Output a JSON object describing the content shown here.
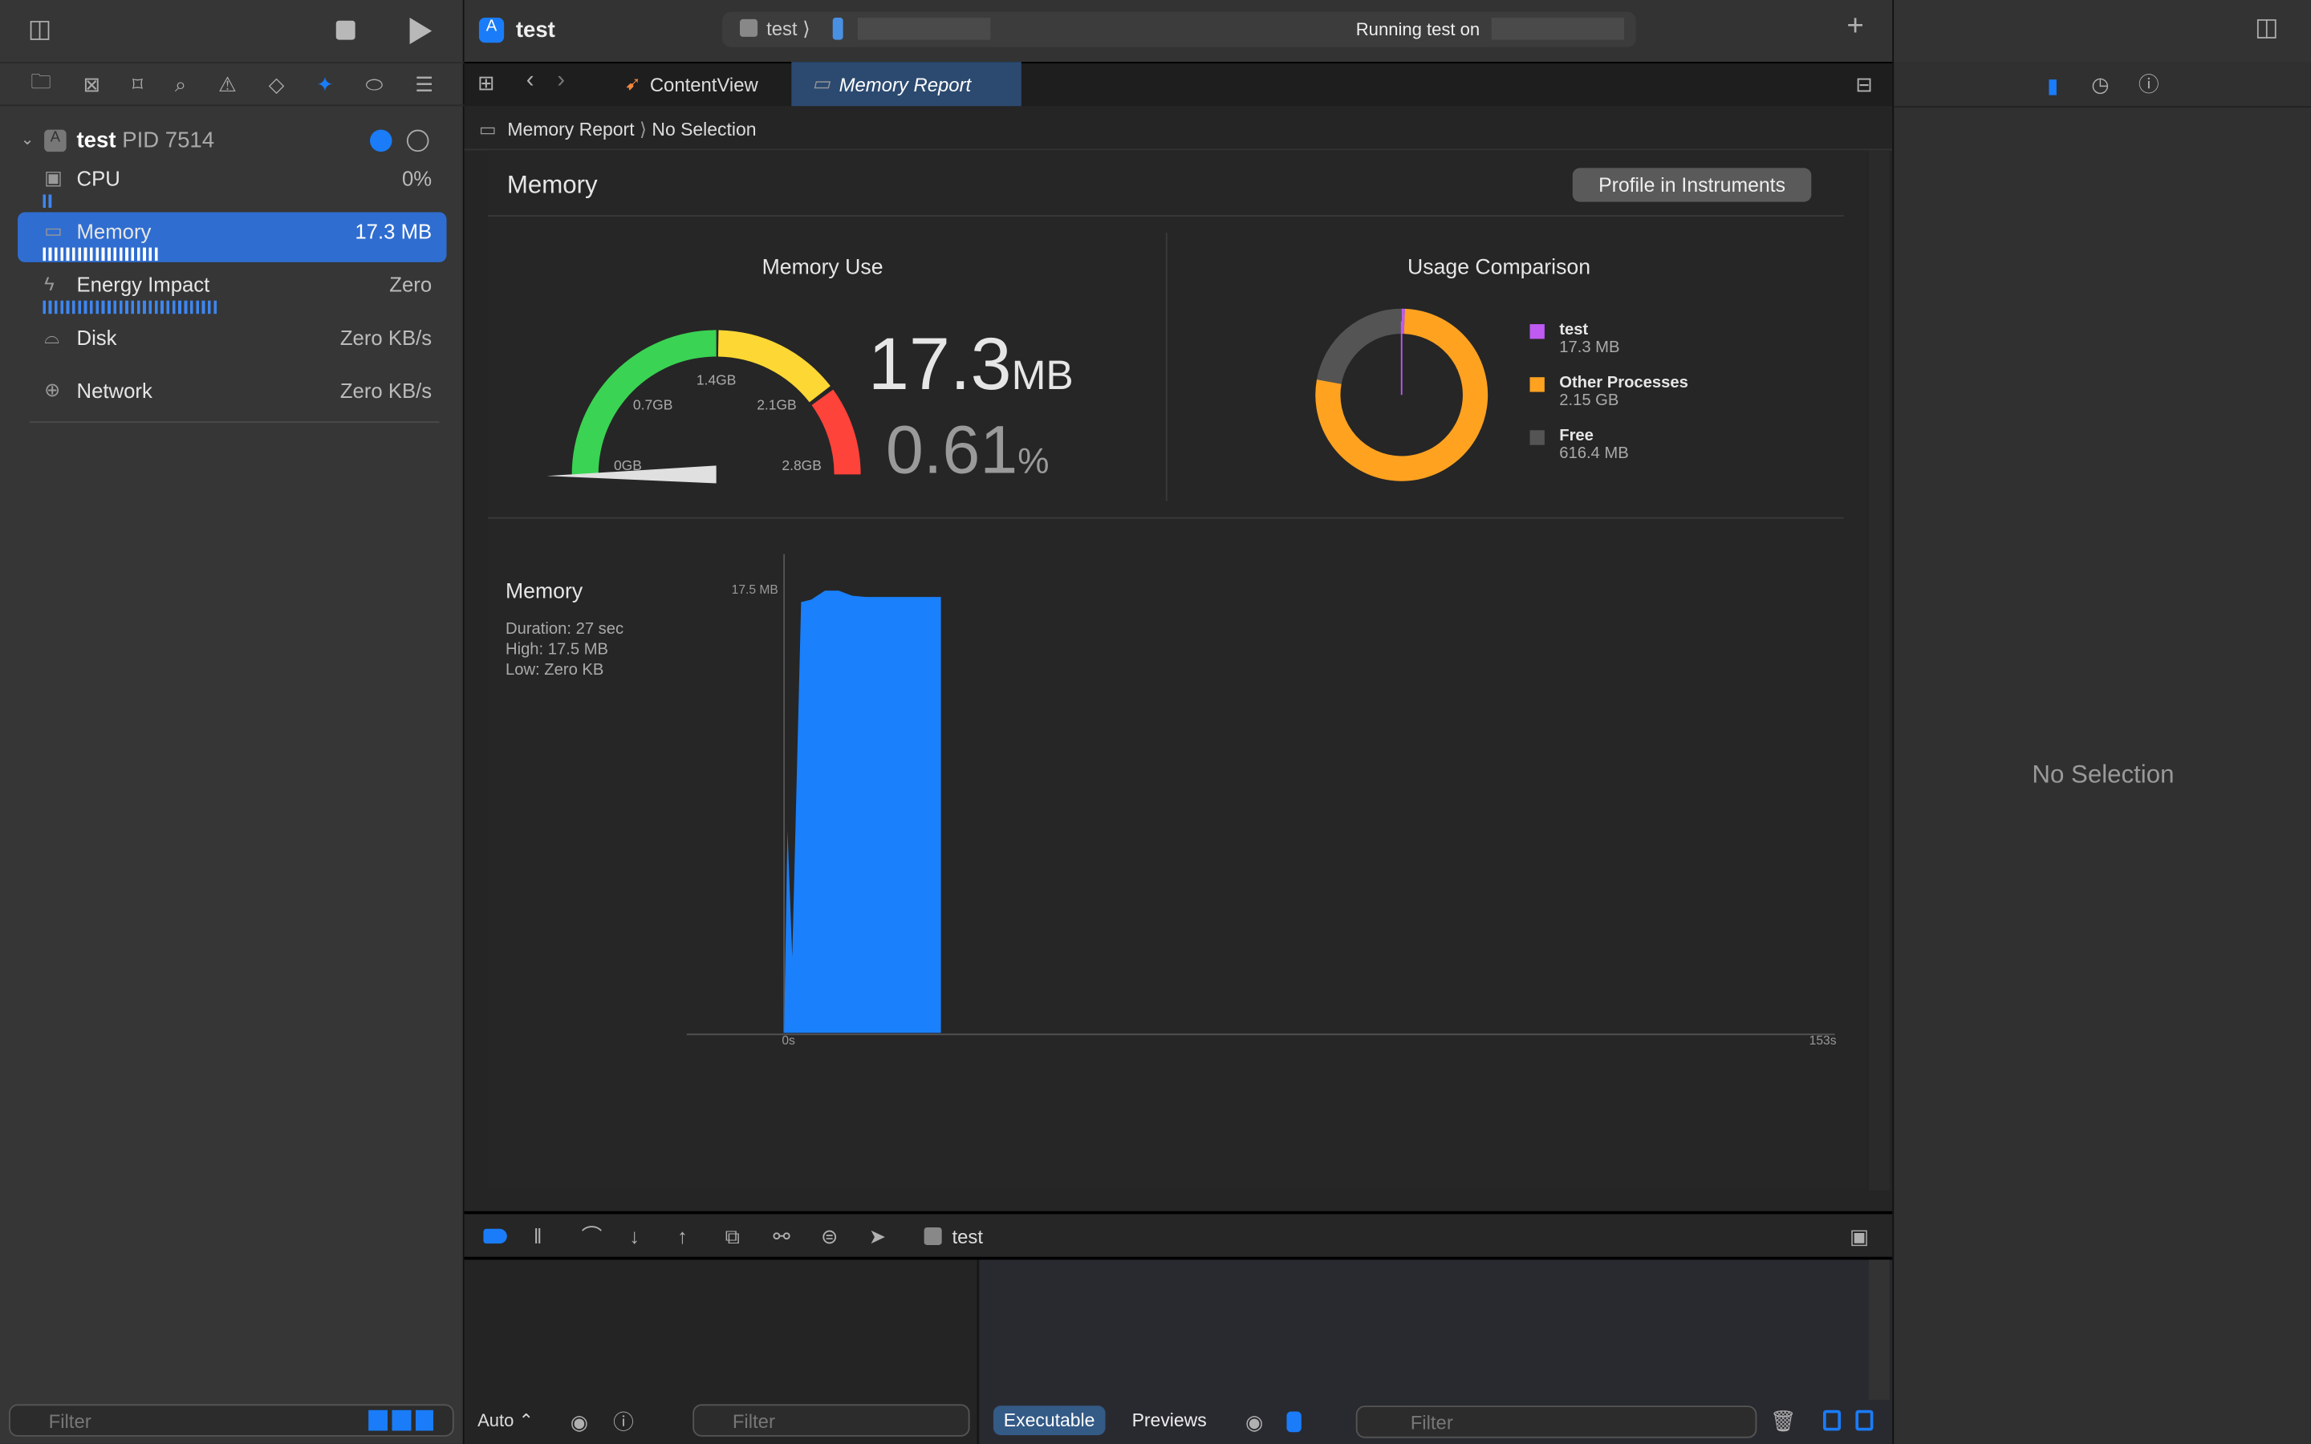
{
  "toolbar": {
    "project": "test",
    "scheme": "test",
    "scheme_sep": "⟩",
    "status": "Running test on",
    "add_icon": "plus-icon"
  },
  "navigator": {
    "icons": [
      "folder-icon",
      "source-control-icon",
      "bookmark-icon",
      "search-icon",
      "warning-icon",
      "test-icon",
      "debug-icon",
      "breakpoint-icon",
      "report-icon"
    ],
    "process": {
      "name": "test",
      "pid": "PID 7514"
    },
    "items": [
      {
        "label": "CPU",
        "value": "0%",
        "icon": "cpu-icon"
      },
      {
        "label": "Memory",
        "value": "17.3 MB",
        "icon": "memory-icon",
        "selected": true
      },
      {
        "label": "Energy Impact",
        "value": "Zero",
        "icon": "bolt-icon"
      },
      {
        "label": "Disk",
        "value": "Zero KB/s",
        "icon": "disk-icon"
      },
      {
        "label": "Network",
        "value": "Zero KB/s",
        "icon": "globe-icon"
      }
    ],
    "filter_placeholder": "Filter"
  },
  "tabs": [
    {
      "label": "ContentView",
      "active": false
    },
    {
      "label": "Memory Report",
      "active": true
    }
  ],
  "breadcrumb": [
    "Memory Report",
    "No Selection"
  ],
  "report": {
    "title": "Memory",
    "profile_button": "Profile in Instruments",
    "memory_use": {
      "title": "Memory Use",
      "value": "17.3",
      "unit": "MB",
      "percent": "0.61",
      "percent_unit": "%",
      "gauge_labels": [
        "0GB",
        "0.7GB",
        "1.4GB",
        "2.1GB",
        "2.8GB"
      ],
      "gauge_fraction": 0.0061,
      "colors": {
        "green": "#3ad353",
        "yellow": "#fdd733",
        "red": "#fd433a"
      }
    },
    "usage": {
      "title": "Usage Comparison",
      "legend": [
        {
          "name": "test",
          "value": "17.3 MB",
          "color": "#bf5af2"
        },
        {
          "name": "Other Processes",
          "value": "2.15 GB",
          "color": "#fea220"
        },
        {
          "name": "Free",
          "value": "616.4 MB",
          "color": "#545454"
        }
      ]
    },
    "timeline": {
      "title": "Memory",
      "duration": "Duration: 27 sec",
      "high": "High: 17.5 MB",
      "low": "Low: Zero KB"
    }
  },
  "chart_data": {
    "type": "area",
    "x_unit": "s",
    "y_unit": "MB",
    "xlim": [
      0,
      153
    ],
    "ylim": [
      0,
      17.5
    ],
    "x_tick_labels": [
      "0s",
      "153s"
    ],
    "y_tick_labels": [
      "17.5 MB"
    ],
    "color": "#1a80fb",
    "points": [
      [
        0,
        0
      ],
      [
        0.5,
        8
      ],
      [
        1.2,
        3
      ],
      [
        2.5,
        17
      ],
      [
        4,
        17.1
      ],
      [
        6,
        17.45
      ],
      [
        8,
        17.45
      ],
      [
        10,
        17.25
      ],
      [
        12,
        17.2
      ],
      [
        23,
        17.2
      ],
      [
        23,
        0
      ]
    ]
  },
  "debug_bar": {
    "process": "test"
  },
  "console": {
    "auto": "Auto ⌃",
    "filter_placeholder": "Filter",
    "executable": "Executable",
    "previews": "Previews"
  },
  "inspector": {
    "empty": "No Selection"
  }
}
